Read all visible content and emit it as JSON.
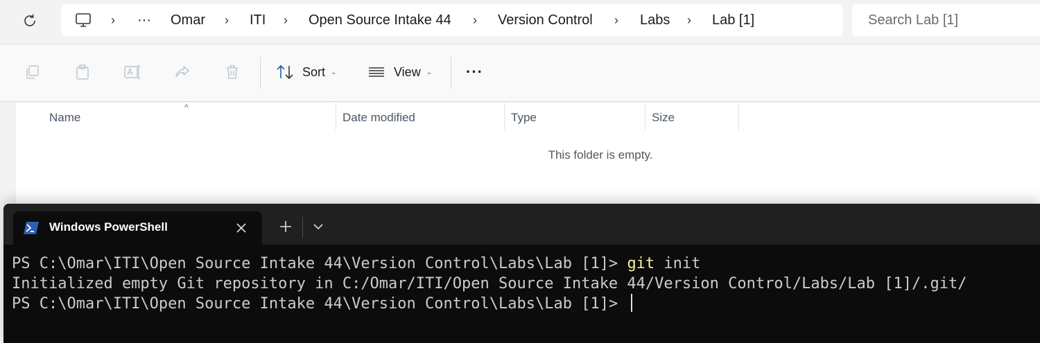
{
  "breadcrumb": {
    "overflow": "···",
    "items": [
      "Omar",
      "ITI",
      "Open Source Intake 44",
      "Version Control",
      "Labs",
      "Lab [1]"
    ],
    "separator": "›"
  },
  "search": {
    "placeholder": "Search Lab [1]"
  },
  "toolbar": {
    "sort_label": "Sort",
    "view_label": "View",
    "more_label": "···",
    "caret": "⌄"
  },
  "columns": {
    "name": "Name",
    "date": "Date modified",
    "type": "Type",
    "size": "Size"
  },
  "list": {
    "empty_message": "This folder is empty."
  },
  "terminal": {
    "tab_title": "Windows PowerShell",
    "prompt": "PS C:\\Omar\\ITI\\Open Source Intake 44\\Version Control\\Labs\\Lab [1]> ",
    "command_keyword": "git",
    "command_args": " init",
    "output": "Initialized empty Git repository in C:/Omar/ITI/Open Source Intake 44/Version Control/Labs/Lab [1]/.git/",
    "colors": {
      "background": "#0c0c0c",
      "text": "#cccccc",
      "command": "#f9f1a5"
    }
  }
}
